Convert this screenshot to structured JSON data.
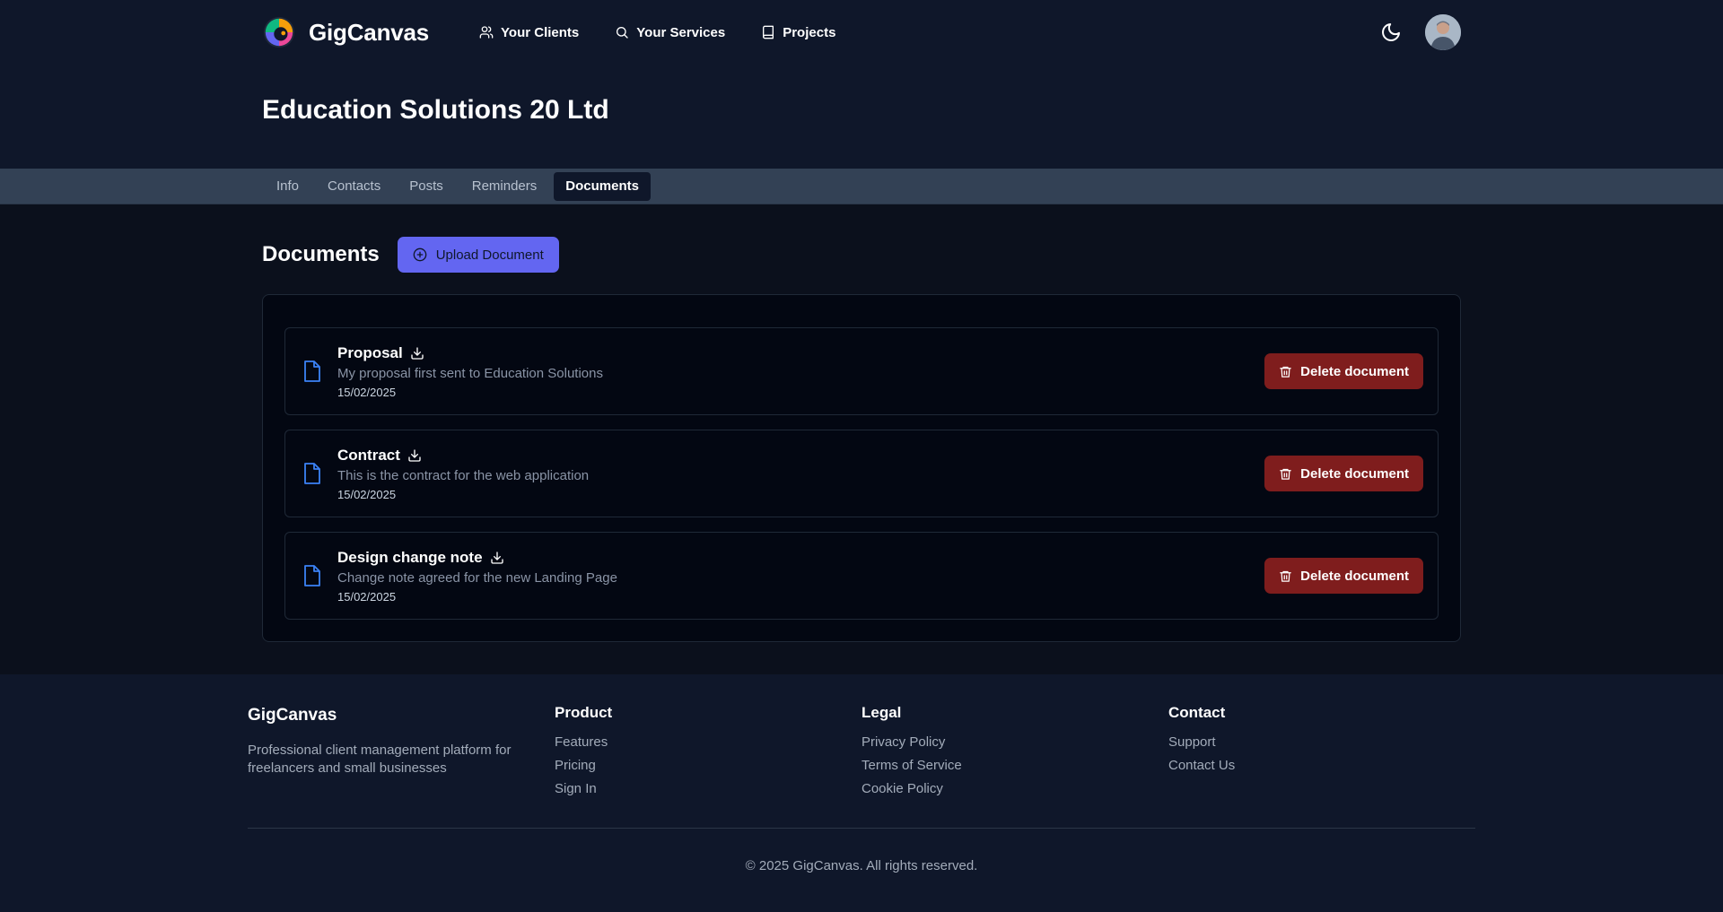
{
  "nav": {
    "brand": "GigCanvas",
    "links": [
      {
        "label": "Your Clients",
        "icon": "users-icon"
      },
      {
        "label": "Your Services",
        "icon": "search-icon"
      },
      {
        "label": "Projects",
        "icon": "book-icon"
      }
    ]
  },
  "page": {
    "title": "Education Solutions 20 Ltd"
  },
  "tabs": [
    {
      "label": "Info",
      "active": false
    },
    {
      "label": "Contacts",
      "active": false
    },
    {
      "label": "Posts",
      "active": false
    },
    {
      "label": "Reminders",
      "active": false
    },
    {
      "label": "Documents",
      "active": true
    }
  ],
  "documents": {
    "heading": "Documents",
    "upload_label": "Upload Document",
    "delete_label": "Delete document",
    "items": [
      {
        "name": "Proposal",
        "description": "My proposal first sent to Education Solutions",
        "date": "15/02/2025"
      },
      {
        "name": "Contract",
        "description": "This is the contract for the web application",
        "date": "15/02/2025"
      },
      {
        "name": "Design change note",
        "description": "Change note agreed for the new Landing Page",
        "date": "15/02/2025"
      }
    ]
  },
  "footer": {
    "brand": "GigCanvas",
    "tagline": "Professional client management platform for freelancers and small businesses",
    "columns": [
      {
        "heading": "Product",
        "links": [
          "Features",
          "Pricing",
          "Sign In"
        ]
      },
      {
        "heading": "Legal",
        "links": [
          "Privacy Policy",
          "Terms of Service",
          "Cookie Policy"
        ]
      },
      {
        "heading": "Contact",
        "links": [
          "Support",
          "Contact Us"
        ]
      }
    ],
    "copyright": "© 2025 GigCanvas. All rights reserved."
  },
  "colors": {
    "background": "#0d1525",
    "accent": "#6366f1",
    "danger": "#7f1d1d",
    "file_icon": "#3b82f6"
  }
}
